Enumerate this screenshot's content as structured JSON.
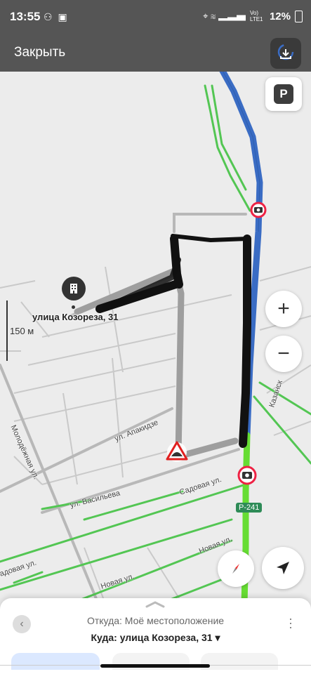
{
  "status_bar": {
    "time": "13:55",
    "left_icons": "⚇ ▣",
    "right_icons": "⌖ ≋ ▂▃▅",
    "network": "Vo) LTE1",
    "battery": "12%"
  },
  "toolbar": {
    "close_label": "Закрыть",
    "download_icon": "download-icon"
  },
  "map": {
    "parking_label": "P",
    "zoom_in": "+",
    "zoom_out": "−",
    "scale_label": "150 м",
    "poi_label": "улица Козореза, 31",
    "poi_icon": "building-icon",
    "road_sign": "Р-241",
    "streets": {
      "molodezhnaya": "Молодёжная ул.",
      "apakidze": "ул. Апакидзе",
      "vasilyeva": "ул. Васильева",
      "sadovaya1": "Садовая ул.",
      "sadovaya2": "адовая ул.",
      "novaya1": "Новая ул.",
      "novaya2": "Новая ул.",
      "kazanskaya": "Казанск"
    },
    "colors": {
      "route_primary": "#3a6cc4",
      "traffic_free": "#66dd33",
      "minor_road": "#53c653",
      "road_grey": "#b8b8b8",
      "drawing": "#111111",
      "background": "#ececec"
    }
  },
  "bottom_sheet": {
    "from_label": "Откуда: Моё местоположение",
    "to_label": "Куда: улица Козореза, 31 ▾",
    "back_icon": "chevron-left-icon",
    "more_icon": "more-vertical-icon"
  }
}
